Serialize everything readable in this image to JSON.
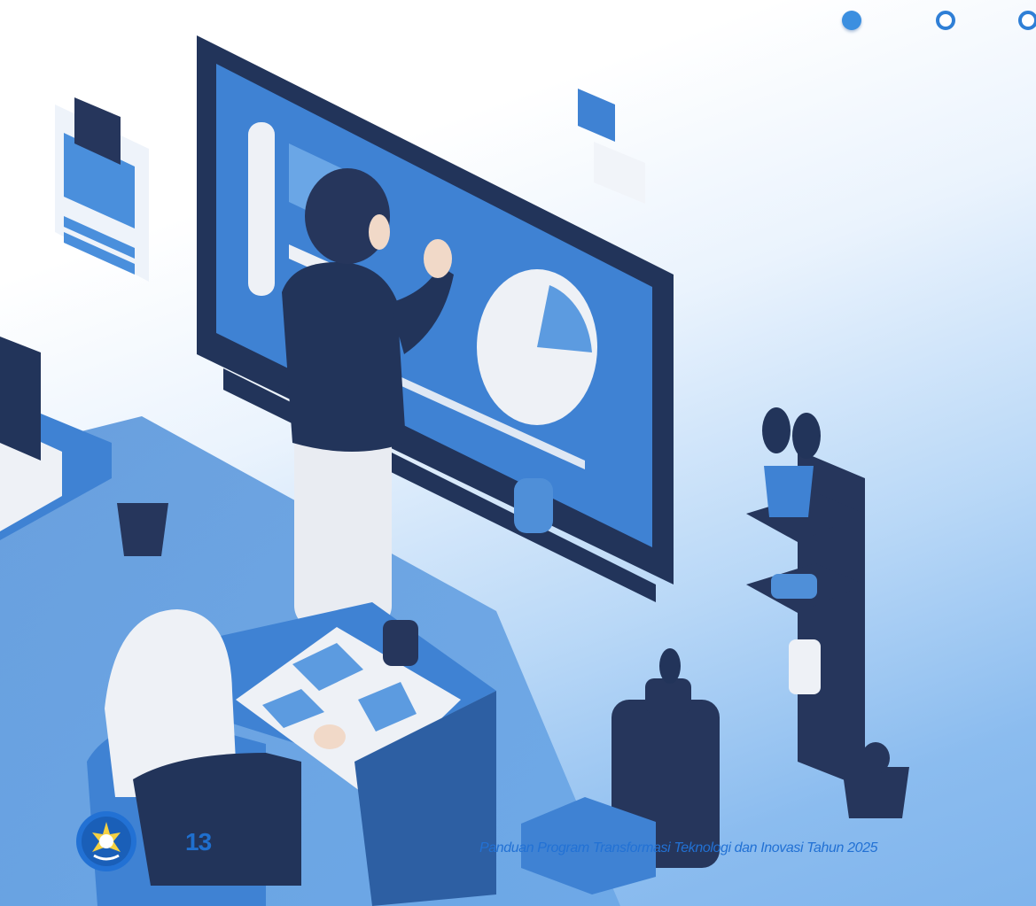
{
  "pagination": {
    "active_index": 0,
    "dot_count": 3
  },
  "footer": {
    "page_number": "13",
    "title": "Panduan Program Transformasi Teknologi dan Inovasi Tahun 2025",
    "logo_icon": "tut-wuri-handayani-logo-icon"
  },
  "colors": {
    "accent": "#2f7fd6",
    "navy": "#22345a",
    "mid_blue": "#3f82d3",
    "light_blue": "#7fb4ec"
  }
}
